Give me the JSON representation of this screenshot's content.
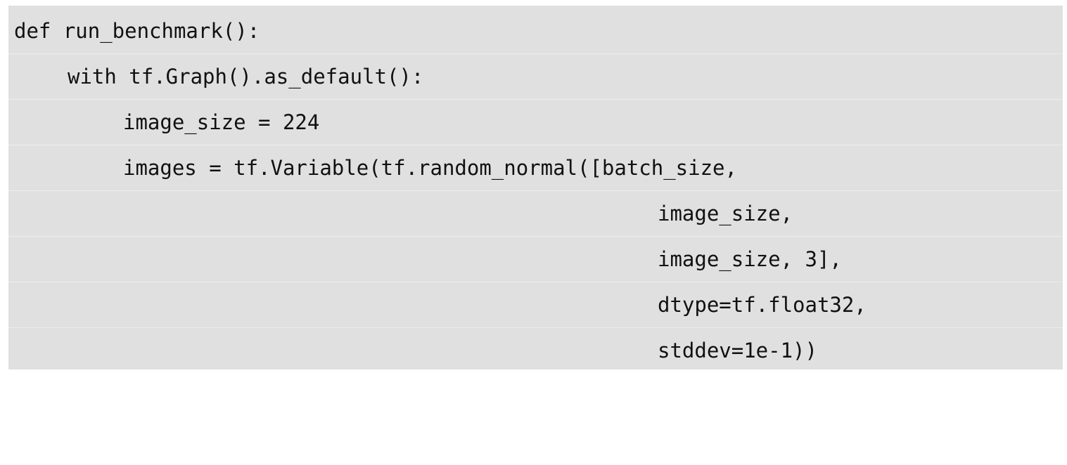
{
  "code": {
    "lines": [
      "def run_benchmark():",
      "with tf.Graph().as_default():",
      "image_size = 224",
      "images = tf.Variable(tf.random_normal([batch_size,",
      "image_size,",
      "image_size, 3],",
      "dtype=tf.float32,",
      "stddev=1e-1))"
    ]
  },
  "colors": {
    "background": "#e0e0e0",
    "text": "#111111",
    "separator": "#ededed"
  }
}
